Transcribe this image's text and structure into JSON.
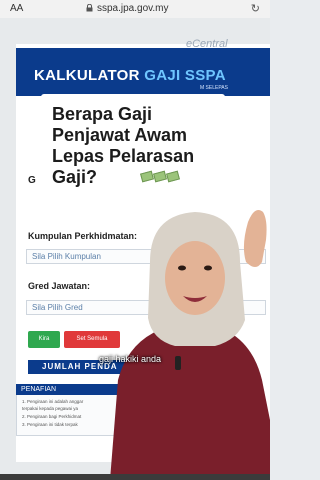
{
  "browser": {
    "text_size_label": "AA",
    "url": "sspa.jpa.gov.my",
    "reload_icon": "reload-icon"
  },
  "watermark": "eCentral",
  "banner": {
    "title_plain": "KALKULATOR",
    "title_accent": "GAJI SSPA",
    "subtitle": "M SELEPAS"
  },
  "form": {
    "gred_top_label": "G",
    "kumpulan_label": "Kumpulan Perkhidmatan:",
    "kumpulan_value": "Sila Pilih Kumpulan",
    "gred_label": "Gred Jawatan:",
    "gred_value": "Sila Pilih Gred",
    "kira_button": "Kira",
    "reset_button": "Set Semula",
    "jumlah_label": "JUMLAH PENDA"
  },
  "penafian": {
    "title": "PENAFIAN",
    "lines": [
      "1.   Pengiraan ini adalah anggar",
      "      terpakai kepada pegawai ya",
      "2.   Pengiraan bagi Perkhidmat",
      "3.   Pengiraan ini tidak terpak"
    ]
  },
  "caption": {
    "line1": "Berapa Gaji",
    "line2": "Penjawat Awam",
    "line3": "Lepas Pelarasan",
    "line4": "Gaji?"
  },
  "subtitle": "gaji hakiki anda",
  "colors": {
    "banner": "#0b3b8c",
    "accent": "#6fc6ff",
    "kira": "#2fa84f",
    "reset": "#e0393a",
    "hijab": "#d9d2c8",
    "shirt": "#7a1f2b"
  }
}
